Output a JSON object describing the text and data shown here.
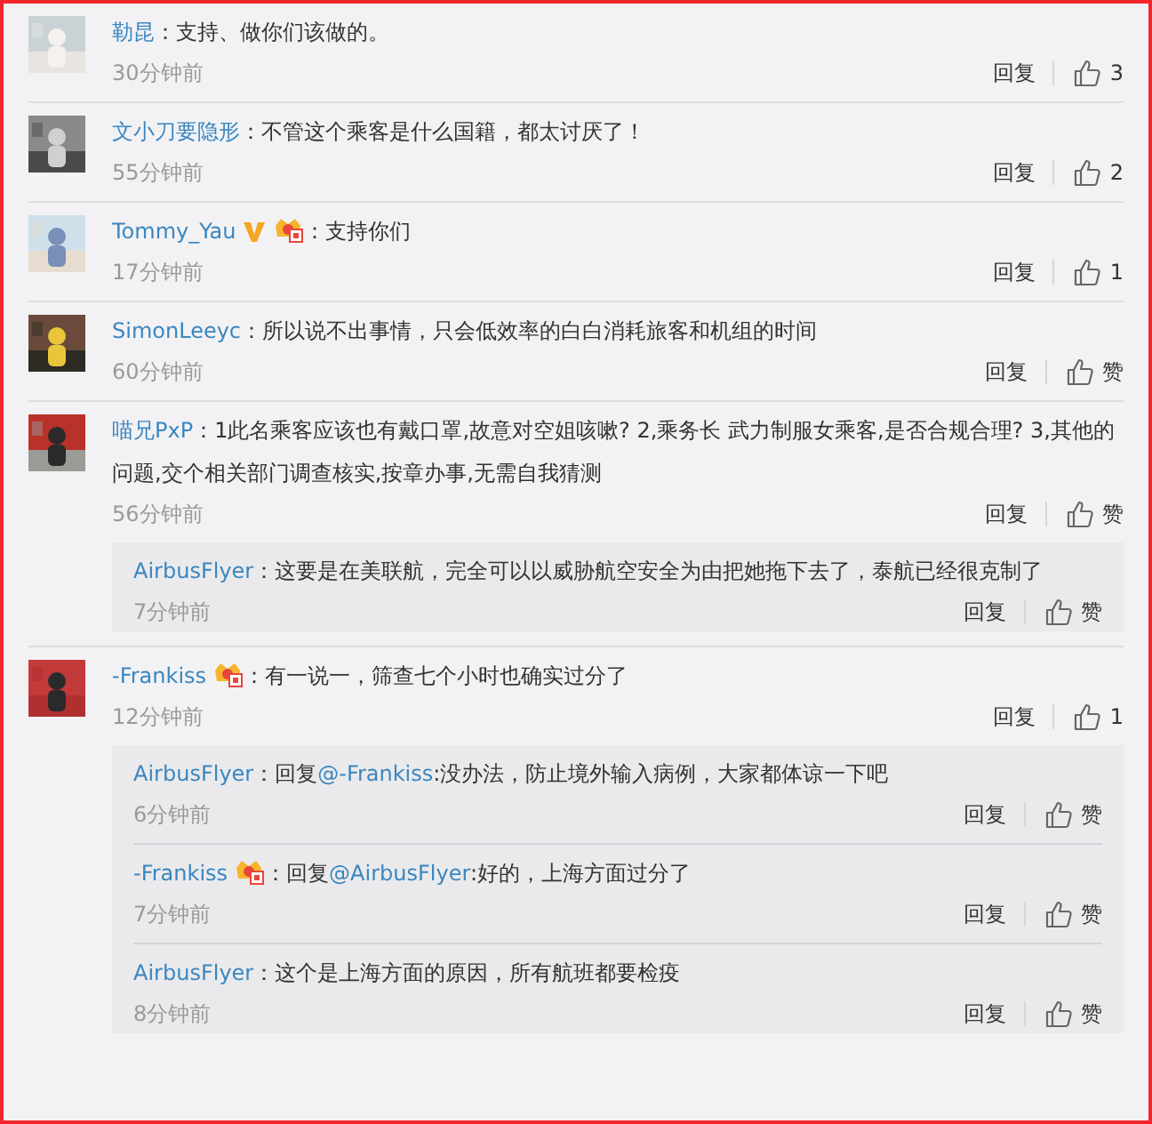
{
  "comments": [
    {
      "name": "勒昆",
      "text": "：支持、做你们该做的。",
      "time": "30分钟前",
      "reply_label": "回复",
      "likes": "3"
    },
    {
      "name": "文小刀要隐形",
      "text": "：不管这个乘客是什么国籍，都太讨厌了！",
      "time": "55分钟前",
      "reply_label": "回复",
      "likes": "2"
    },
    {
      "name": "Tommy_Yau",
      "badges": [
        {
          "kind": "verified"
        },
        {
          "kind": "vip"
        }
      ],
      "text": "：支持你们",
      "time": "17分钟前",
      "reply_label": "回复",
      "likes": "1"
    },
    {
      "name": "SimonLeeyc",
      "text": "：所以说不出事情，只会低效率的白白消耗旅客和机组的时间",
      "time": "60分钟前",
      "reply_label": "回复",
      "likes": "赞"
    },
    {
      "name": "喵兄PxP",
      "text": "：1此名乘客应该也有戴口罩,故意对空姐咳嗽? 2,乘务长 武力制服女乘客,是否合规合理? 3,其他的问题,交个相关部门调查核实,按章办事,无需自我猜测",
      "time": "56分钟前",
      "reply_label": "回复",
      "likes": "赞",
      "replies": [
        {
          "name": "AirbusFlyer",
          "text": "：这要是在美联航，完全可以以威胁航空安全为由把她拖下去了，泰航已经很克制了",
          "time": "7分钟前",
          "reply_label": "回复",
          "likes": "赞"
        }
      ]
    },
    {
      "name": "-Frankiss",
      "badges": [
        {
          "kind": "vip"
        }
      ],
      "text": "：有一说一，筛查七个小时也确实过分了",
      "time": "12分钟前",
      "reply_label": "回复",
      "likes": "1",
      "replies": [
        {
          "name": "AirbusFlyer",
          "prefix": "：回复",
          "mention": "@-Frankiss",
          "text": ":没办法，防止境外输入病例，大家都体谅一下吧",
          "time": "6分钟前",
          "reply_label": "回复",
          "likes": "赞"
        },
        {
          "name": "-Frankiss",
          "badges": [
            {
              "kind": "vip"
            }
          ],
          "prefix": "：回复",
          "mention": "@AirbusFlyer",
          "text": ":好的，上海方面过分了",
          "time": "7分钟前",
          "reply_label": "回复",
          "likes": "赞"
        },
        {
          "name": "AirbusFlyer",
          "text": "：这个是上海方面的原因，所有航班都要检疫",
          "time": "8分钟前",
          "reply_label": "回复",
          "likes": "赞"
        }
      ]
    }
  ]
}
